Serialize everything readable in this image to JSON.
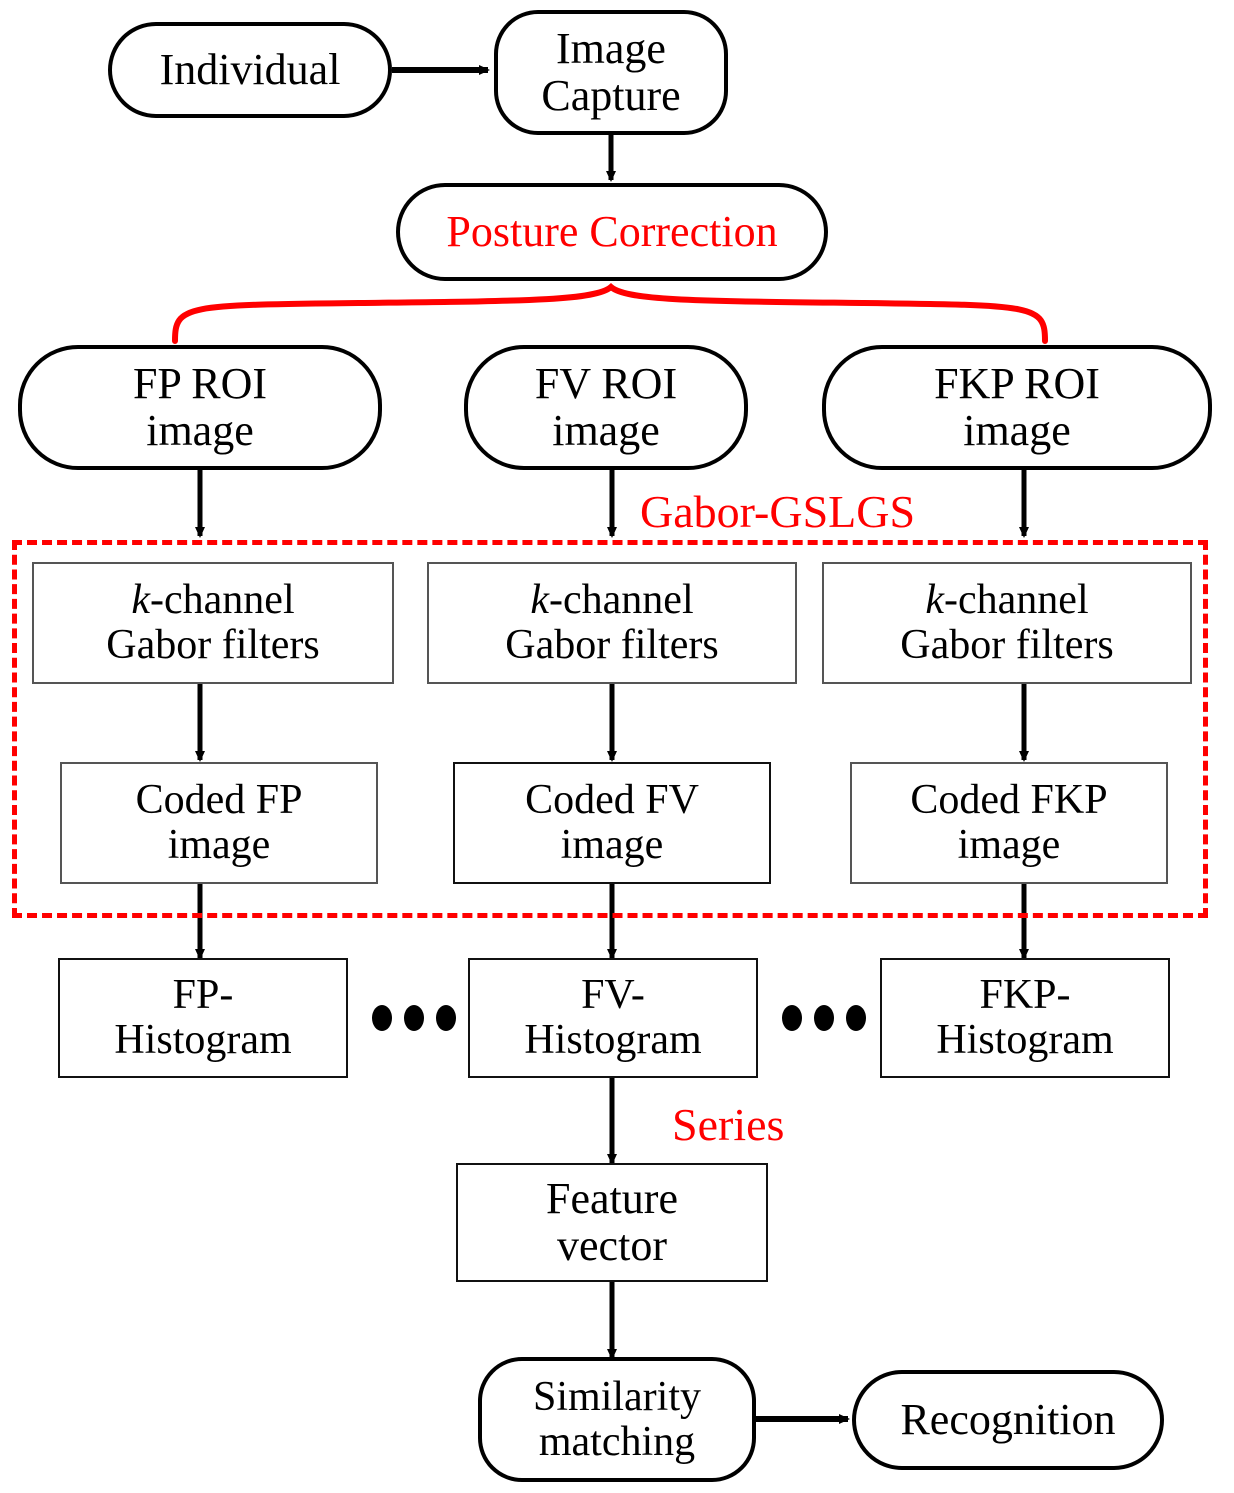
{
  "diagram": {
    "title_semantic": "multimodal-finger-biometrics-recognition-pipeline",
    "colors": {
      "accent_red": "#ff0000",
      "node_stroke": "#000000",
      "rect_stroke": "#555555",
      "background": "#ffffff"
    },
    "nodes": {
      "individual": {
        "label": "Individual"
      },
      "image_capture": {
        "line1": "Image",
        "line2": "Capture"
      },
      "posture_correction": {
        "label": "Posture Correction"
      },
      "fp_roi": {
        "line1": "FP ROI",
        "line2": "image"
      },
      "fv_roi": {
        "line1": "FV ROI",
        "line2": "image"
      },
      "fkp_roi": {
        "line1": "FKP ROI",
        "line2": "image"
      },
      "gabor_fp": {
        "line1_italic": "k",
        "line1_rest": "-channel",
        "line2": "Gabor filters"
      },
      "gabor_fv": {
        "line1_italic": "k",
        "line1_rest": "-channel",
        "line2": "Gabor filters"
      },
      "gabor_fkp": {
        "line1_italic": "k",
        "line1_rest": "-channel",
        "line2": "Gabor filters"
      },
      "coded_fp": {
        "line1": "Coded FP",
        "line2": "image"
      },
      "coded_fv": {
        "line1": "Coded FV",
        "line2": "image"
      },
      "coded_fkp": {
        "line1": "Coded FKP",
        "line2": "image"
      },
      "hist_fp": {
        "line1": "FP-",
        "line2": "Histogram"
      },
      "hist_fv": {
        "line1": "FV-",
        "line2": "Histogram"
      },
      "hist_fkp": {
        "line1": "FKP-",
        "line2": "Histogram"
      },
      "feature_vector": {
        "line1": "Feature",
        "line2": "vector"
      },
      "similarity_matching": {
        "line1": "Similarity",
        "line2": "matching"
      },
      "recognition": {
        "label": "Recognition"
      }
    },
    "annotations": {
      "gabor_gslgs": "Gabor-GSLGS",
      "series": "Series"
    },
    "ellipses": {
      "left_dots": "• • •",
      "right_dots": "• • •"
    }
  }
}
